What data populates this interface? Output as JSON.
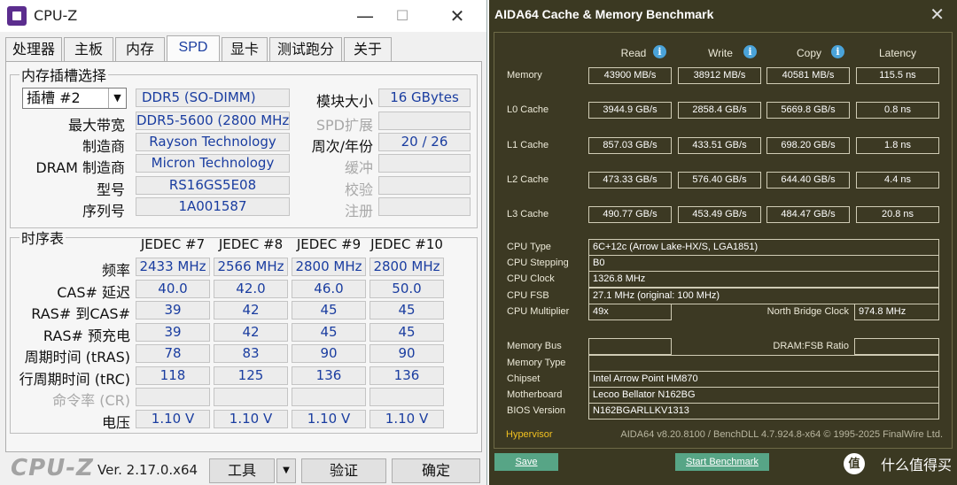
{
  "cpuz": {
    "title": "CPU-Z",
    "window_controls": {
      "minimize": "—",
      "maximize": "☐",
      "close": "✕"
    },
    "tabs": [
      "处理器",
      "主板",
      "内存",
      "SPD",
      "显卡",
      "测试跑分",
      "关于"
    ],
    "active_tab": "SPD",
    "slot_group": {
      "legend": "内存插槽选择",
      "slot_value": "插槽 #2",
      "type": "DDR5 (SO-DIMM)",
      "module_size_label": "模块大小",
      "module_size": "16 GBytes",
      "max_bandwidth_label": "最大带宽",
      "max_bandwidth": "DDR5-5600 (2800 MHz)",
      "spd_ext_label": "SPD扩展",
      "spd_ext": "",
      "manufacturer_label": "制造商",
      "manufacturer": "Rayson Technology",
      "week_year_label": "周次/年份",
      "week_year": "20 / 26",
      "dram_mfr_label": "DRAM 制造商",
      "dram_mfr": "Micron Technology",
      "buffered_label": "缓冲",
      "buffered": "",
      "part_label": "型号",
      "part": "RS16GS5E08",
      "correction_label": "校验",
      "correction": "",
      "serial_label": "序列号",
      "serial": "1A001587",
      "registered_label": "注册",
      "registered": ""
    },
    "timings": {
      "legend": "时序表",
      "columns": [
        "JEDEC #7",
        "JEDEC #8",
        "JEDEC #9",
        "JEDEC #10"
      ],
      "rows": [
        {
          "label": "频率",
          "dim": false,
          "values": [
            "2433 MHz",
            "2566 MHz",
            "2800 MHz",
            "2800 MHz"
          ]
        },
        {
          "label": "CAS# 延迟",
          "dim": false,
          "values": [
            "40.0",
            "42.0",
            "46.0",
            "50.0"
          ]
        },
        {
          "label": "RAS# 到CAS#",
          "dim": false,
          "values": [
            "39",
            "42",
            "45",
            "45"
          ]
        },
        {
          "label": "RAS# 预充电",
          "dim": false,
          "values": [
            "39",
            "42",
            "45",
            "45"
          ]
        },
        {
          "label": "周期时间 (tRAS)",
          "dim": false,
          "values": [
            "78",
            "83",
            "90",
            "90"
          ]
        },
        {
          "label": "行周期时间 (tRC)",
          "dim": false,
          "values": [
            "118",
            "125",
            "136",
            "136"
          ]
        },
        {
          "label": "命令率 (CR)",
          "dim": true,
          "values": [
            "",
            "",
            "",
            ""
          ]
        },
        {
          "label": "电压",
          "dim": false,
          "values": [
            "1.10 V",
            "1.10 V",
            "1.10 V",
            "1.10 V"
          ]
        }
      ]
    },
    "footer": {
      "brand": "CPU-Z",
      "version": "Ver. 2.17.0.x64",
      "tools_label": "工具",
      "validate_label": "验证",
      "ok_label": "确定"
    }
  },
  "aida": {
    "title": "AIDA64 Cache & Memory Benchmark",
    "close_glyph": "✕",
    "headers": [
      "Read",
      "Write",
      "Copy",
      "Latency"
    ],
    "bench_rows": [
      {
        "label": "Memory",
        "values": [
          "43900 MB/s",
          "38912 MB/s",
          "40581 MB/s",
          "115.5 ns"
        ]
      },
      {
        "label": "L0 Cache",
        "values": [
          "3944.9 GB/s",
          "2858.4 GB/s",
          "5669.8 GB/s",
          "0.8 ns"
        ]
      },
      {
        "label": "L1 Cache",
        "values": [
          "857.03 GB/s",
          "433.51 GB/s",
          "698.20 GB/s",
          "1.8 ns"
        ]
      },
      {
        "label": "L2 Cache",
        "values": [
          "473.33 GB/s",
          "576.40 GB/s",
          "644.40 GB/s",
          "4.4 ns"
        ]
      },
      {
        "label": "L3 Cache",
        "values": [
          "490.77 GB/s",
          "453.49 GB/s",
          "484.47 GB/s",
          "20.8 ns"
        ]
      }
    ],
    "cpu_type_label": "CPU Type",
    "cpu_type": "6C+12c  (Arrow Lake-HX/S, LGA1851)",
    "cpu_stepping_label": "CPU Stepping",
    "cpu_stepping": "B0",
    "cpu_clock_label": "CPU Clock",
    "cpu_clock": "1326.8 MHz",
    "cpu_fsb_label": "CPU FSB",
    "cpu_fsb": "27.1 MHz  (original: 100 MHz)",
    "cpu_multiplier_label": "CPU Multiplier",
    "cpu_multiplier": "49x",
    "nb_clock_label": "North Bridge Clock",
    "nb_clock": "974.8 MHz",
    "memory_bus_label": "Memory Bus",
    "memory_bus": "",
    "dram_fsb_label": "DRAM:FSB Ratio",
    "dram_fsb": "",
    "memory_type_label": "Memory Type",
    "memory_type": "",
    "chipset_label": "Chipset",
    "chipset": "Intel Arrow Point HM870",
    "motherboard_label": "Motherboard",
    "motherboard": "Lecoo Bellator N162BG",
    "bios_label": "BIOS Version",
    "bios": "N162BGARLLKV1313",
    "hypervisor_label": "Hypervisor",
    "copyright": "AIDA64 v8.20.8100 / BenchDLL 4.7.924.8-x64  © 1995-2025 FinalWire Ltd.",
    "save_label": "Save",
    "start_label": "Start Benchmark"
  },
  "watermark": {
    "icon_text": "值",
    "text": "什么值得买"
  }
}
